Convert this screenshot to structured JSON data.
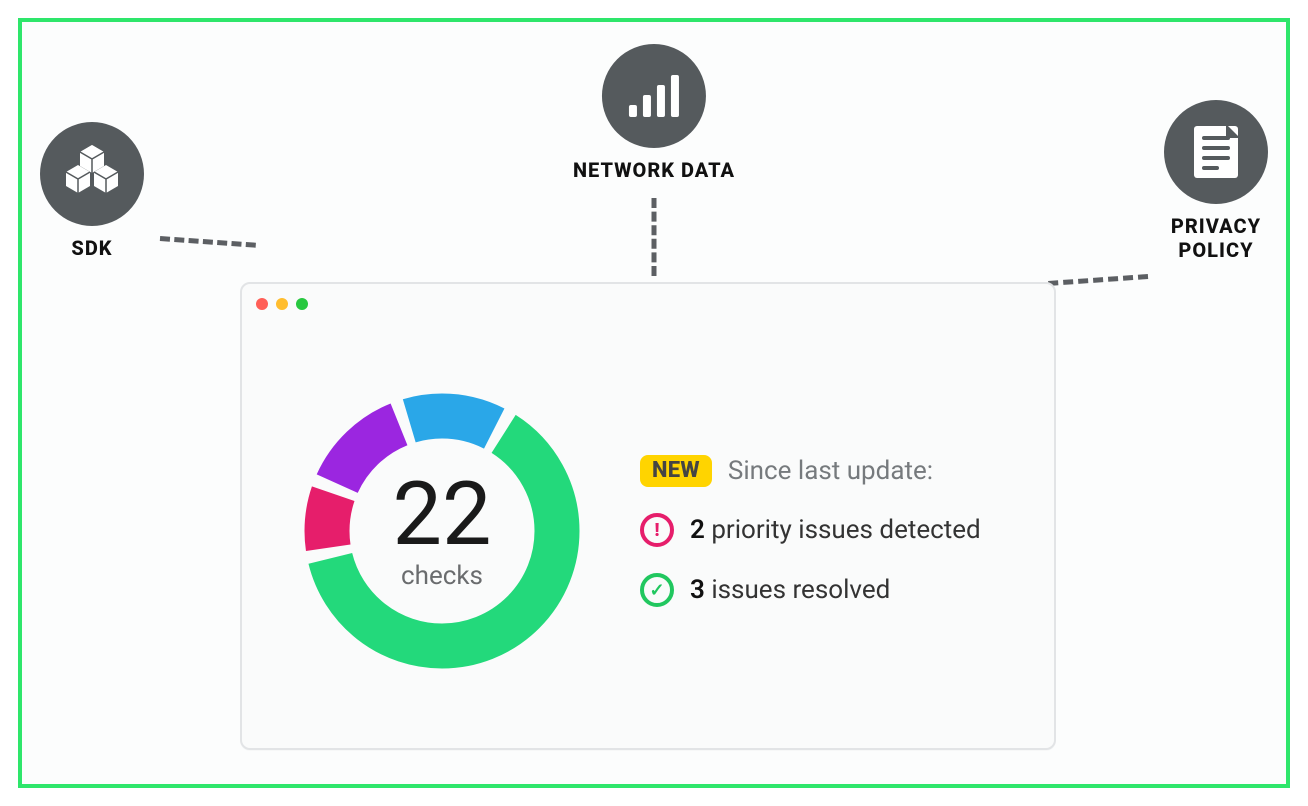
{
  "nodes": {
    "sdk": {
      "label": "SDK",
      "icon": "cubes-icon"
    },
    "network": {
      "label": "NETWORK DATA",
      "icon": "bars-icon"
    },
    "privacy": {
      "label": "PRIVACY\nPOLICY",
      "icon": "document-icon"
    }
  },
  "window": {
    "badge": "NEW",
    "since_label": "Since last update:",
    "priority_count": "2",
    "priority_text": "priority issues detected",
    "resolved_count": "3",
    "resolved_text": "issues resolved",
    "checks_value": "22",
    "checks_label": "checks"
  },
  "chart_data": {
    "type": "pie",
    "title": "22 checks",
    "series": [
      {
        "name": "green",
        "value": 14,
        "color": "#23d97b"
      },
      {
        "name": "magenta",
        "value": 2,
        "color": "#e61e6b"
      },
      {
        "name": "purple",
        "value": 3,
        "color": "#9b26e0"
      },
      {
        "name": "blue",
        "value": 3,
        "color": "#2aa7e8"
      }
    ],
    "total": 22,
    "center_label": "checks",
    "donut": true
  },
  "colors": {
    "frame": "#2ee66b",
    "node_circle": "#555a5d",
    "badge_bg": "#ffd400",
    "alert": "#e61e6b",
    "ok": "#21c75f"
  }
}
